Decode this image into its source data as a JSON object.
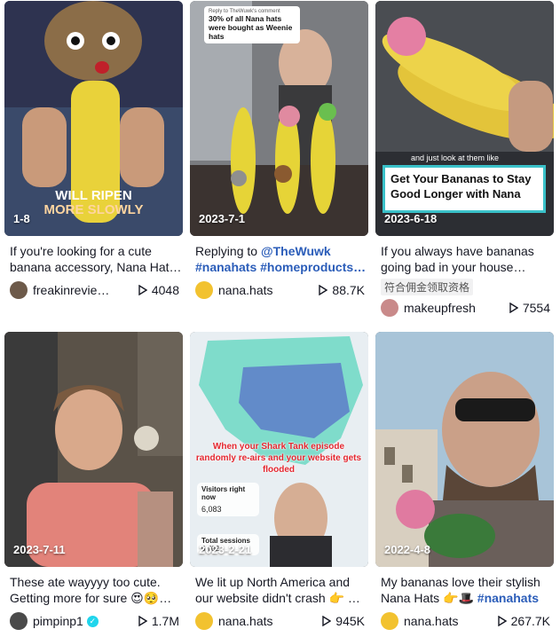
{
  "videos": [
    {
      "date": "1-8",
      "overlay": [
        "WILL RIPEN",
        "MORE SLOWLY"
      ],
      "caption": "If you're looking for a cute banana accessory, Nana Hat…",
      "author": "freakinrevie…",
      "views": "4048",
      "avatar_color": "#6d5a4a"
    },
    {
      "date": "2023-7-1",
      "reply_sub": "Reply to TheWuwk's comment",
      "reply_text": "30% of all Nana hats were bought as Weenie hats",
      "caption_prefix": "Replying to ",
      "caption_mention": "@TheWuwk",
      "caption_tags": "#nanahats #homeproducts…",
      "author": "nana.hats",
      "views": "88.7K",
      "avatar_color": "#f2c230"
    },
    {
      "date": "2023-6-18",
      "sub_text": "and just look at them like",
      "box_text": "Get Your Bananas to Stay Good Longer with Nana",
      "caption": "If you always have bananas going bad in your house…",
      "promo": "符合佣金领取资格",
      "author": "makeupfresh",
      "views": "7554",
      "avatar_color": "#c98a8a"
    },
    {
      "date": "2023-7-11",
      "caption": "These ate wayyyy too cute. Getting more for sure 😍🥺…",
      "author": "pimpinp1",
      "verified": true,
      "views": "1.7M",
      "avatar_color": "#4a4a4a"
    },
    {
      "date": "2023-2-21",
      "red_caption": "When your Shark Tank episode randomly re-airs and your website gets flooded",
      "stat1_label": "Visitors right now",
      "stat1_value": "6,083",
      "stat2_label": "Total sessions",
      "stat2_value": "6,702",
      "caption": "We lit up North America and our website didn't crash 👉 …",
      "author": "nana.hats",
      "views": "945K",
      "avatar_color": "#f2c230"
    },
    {
      "date": "2022-4-8",
      "caption_text": "My bananas love their stylish Nana Hats 👉🎩 ",
      "caption_tag": "#nanahats",
      "author": "nana.hats",
      "views": "267.7K",
      "avatar_color": "#f2c230"
    }
  ]
}
